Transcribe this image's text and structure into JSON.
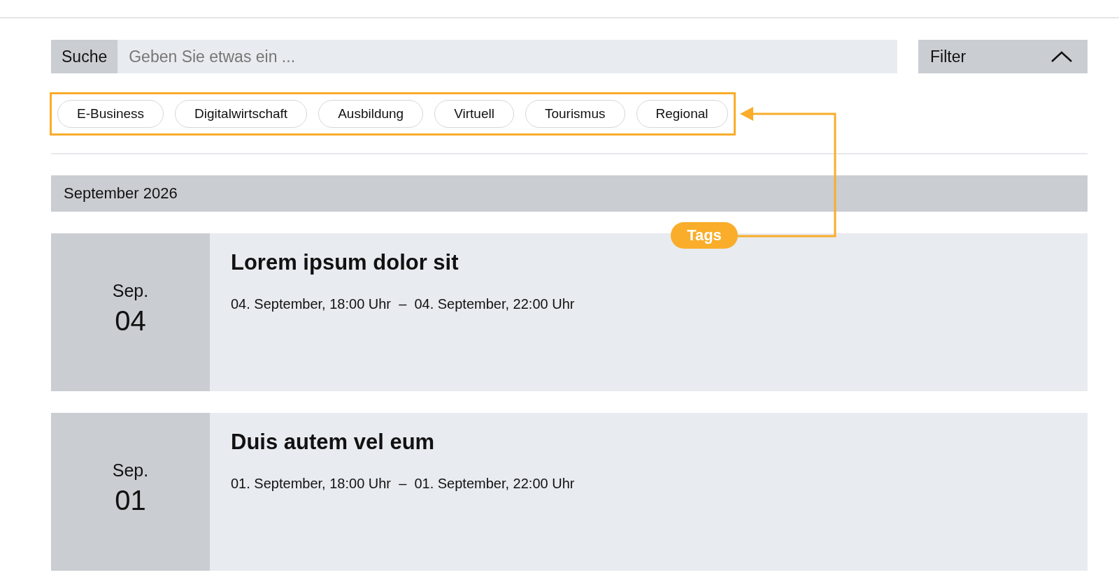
{
  "search": {
    "label": "Suche",
    "placeholder": "Geben Sie etwas ein ..."
  },
  "filter": {
    "label": "Filter",
    "expanded": true
  },
  "tags": [
    "E-Business",
    "Digitalwirtschaft",
    "Ausbildung",
    "Virtuell",
    "Tourismus",
    "Regional"
  ],
  "annotation": {
    "label": "Tags"
  },
  "month": "September 2026",
  "events": [
    {
      "month": "Sep.",
      "day": "04",
      "title": "Lorem ipsum dolor sit",
      "time": "04. September, 18:00 Uhr  –  04. September, 22:00 Uhr"
    },
    {
      "month": "Sep.",
      "day": "01",
      "title": "Duis autem vel eum",
      "time": "01. September, 18:00 Uhr  –  01. September, 22:00 Uhr"
    }
  ]
}
